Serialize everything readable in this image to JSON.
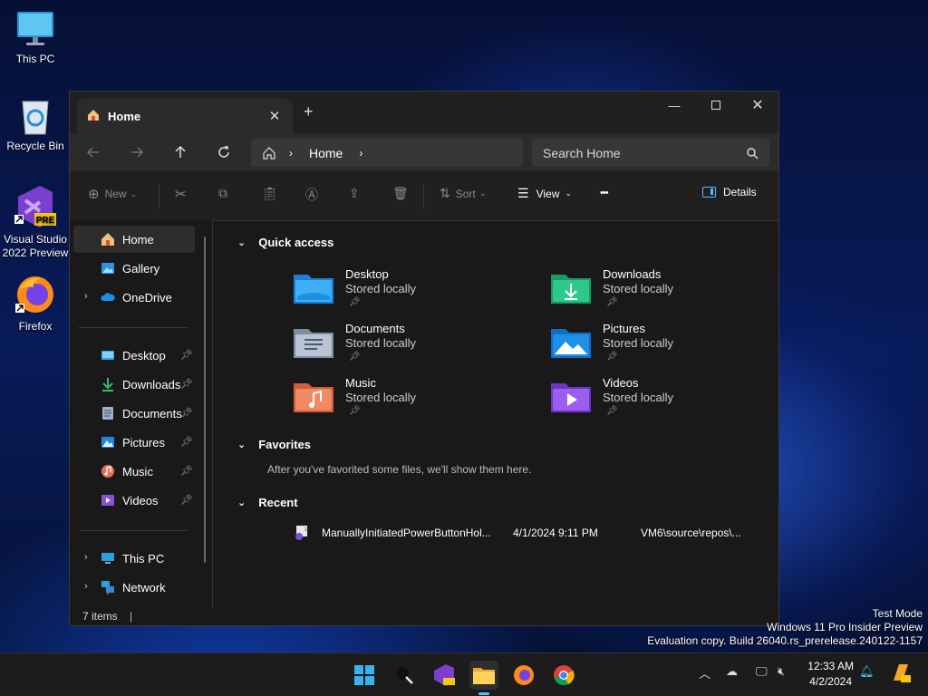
{
  "desktop": {
    "icons": [
      {
        "label": "This PC"
      },
      {
        "label": "Recycle Bin"
      },
      {
        "label": "Visual Studio 2022 Preview"
      },
      {
        "label": "Firefox"
      }
    ]
  },
  "explorer": {
    "tab_title": "Home",
    "new_tab": "+",
    "address": {
      "segment": "Home"
    },
    "search_placeholder": "Search Home",
    "toolbar": {
      "new_label": "New",
      "sort_label": "Sort",
      "view_label": "View",
      "more_label": "•••",
      "details_label": "Details"
    },
    "sidebar": {
      "home": "Home",
      "gallery": "Gallery",
      "onedrive": "OneDrive",
      "pinned": [
        "Desktop",
        "Downloads",
        "Documents",
        "Pictures",
        "Music",
        "Videos"
      ],
      "this_pc": "This PC",
      "network": "Network"
    },
    "quick_access": {
      "title": "Quick access",
      "items": [
        {
          "name": "Desktop",
          "status": "Stored locally"
        },
        {
          "name": "Downloads",
          "status": "Stored locally"
        },
        {
          "name": "Documents",
          "status": "Stored locally"
        },
        {
          "name": "Pictures",
          "status": "Stored locally"
        },
        {
          "name": "Music",
          "status": "Stored locally"
        },
        {
          "name": "Videos",
          "status": "Stored locally"
        }
      ]
    },
    "favorites": {
      "title": "Favorites",
      "empty_text": "After you've favorited some files, we'll show them here."
    },
    "recent": {
      "title": "Recent",
      "rows": [
        {
          "name": "ManuallyInitiatedPowerButtonHol...",
          "date": "4/1/2024 9:11 PM",
          "location": "VM6\\source\\repos\\..."
        }
      ]
    },
    "status": "7 items"
  },
  "watermark": {
    "line1": "Test Mode",
    "line2": "Windows 11 Pro Insider Preview",
    "line3": "Evaluation copy. Build 26040.rs_prerelease.240122-1157"
  },
  "taskbar": {
    "time": "12:33 AM",
    "date": "4/2/2024",
    "vs_badge": "PRE"
  },
  "colors": {
    "accent": "#4cc2ff",
    "window_bg": "#191919",
    "toolbar_bg": "#202020",
    "navbar_bg": "#2b2b2b"
  }
}
